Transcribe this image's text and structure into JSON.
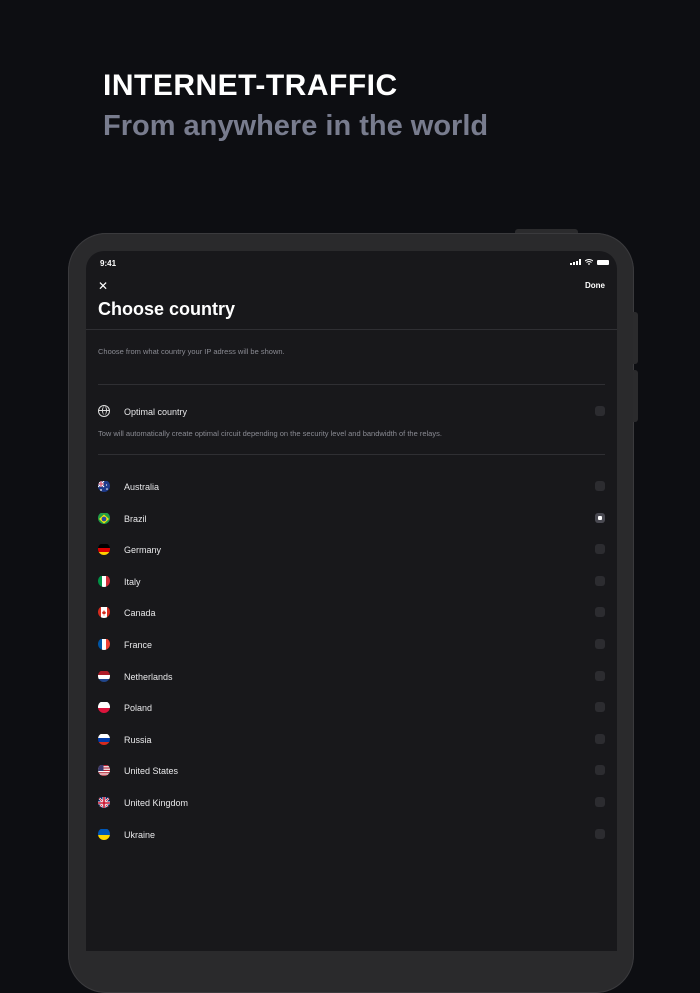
{
  "hero": {
    "title": "INTERNET-TRAFFIC",
    "subtitle": "From anywhere in the world"
  },
  "status": {
    "time": "9:41"
  },
  "header": {
    "close_label": "✕",
    "done_label": "Done",
    "title": "Choose country"
  },
  "subtitle": "Choose from what country your IP adress will be shown.",
  "optimal": {
    "label": "Optimal country",
    "description": "Tow will automatically create optimal circuit depending on the security level and bandwidth of the relays.",
    "selected": false
  },
  "countries": [
    {
      "name": "Australia",
      "icon": "australia-flag-icon",
      "selected": false
    },
    {
      "name": "Brazil",
      "icon": "brazil-flag-icon",
      "selected": true
    },
    {
      "name": "Germany",
      "icon": "germany-flag-icon",
      "selected": false
    },
    {
      "name": "Italy",
      "icon": "italy-flag-icon",
      "selected": false
    },
    {
      "name": "Canada",
      "icon": "canada-flag-icon",
      "selected": false
    },
    {
      "name": "France",
      "icon": "france-flag-icon",
      "selected": false
    },
    {
      "name": "Netherlands",
      "icon": "netherlands-flag-icon",
      "selected": false
    },
    {
      "name": "Poland",
      "icon": "poland-flag-icon",
      "selected": false
    },
    {
      "name": "Russia",
      "icon": "russia-flag-icon",
      "selected": false
    },
    {
      "name": "United States",
      "icon": "united-states-flag-icon",
      "selected": false
    },
    {
      "name": "United Kingdom",
      "icon": "united-kingdom-flag-icon",
      "selected": false
    },
    {
      "name": "Ukraine",
      "icon": "ukraine-flag-icon",
      "selected": false
    }
  ],
  "colors": {
    "background": "#0d0e12",
    "screen": "#18181b",
    "muted_text": "#8a8b93",
    "hero_subtitle": "#787c8e"
  }
}
